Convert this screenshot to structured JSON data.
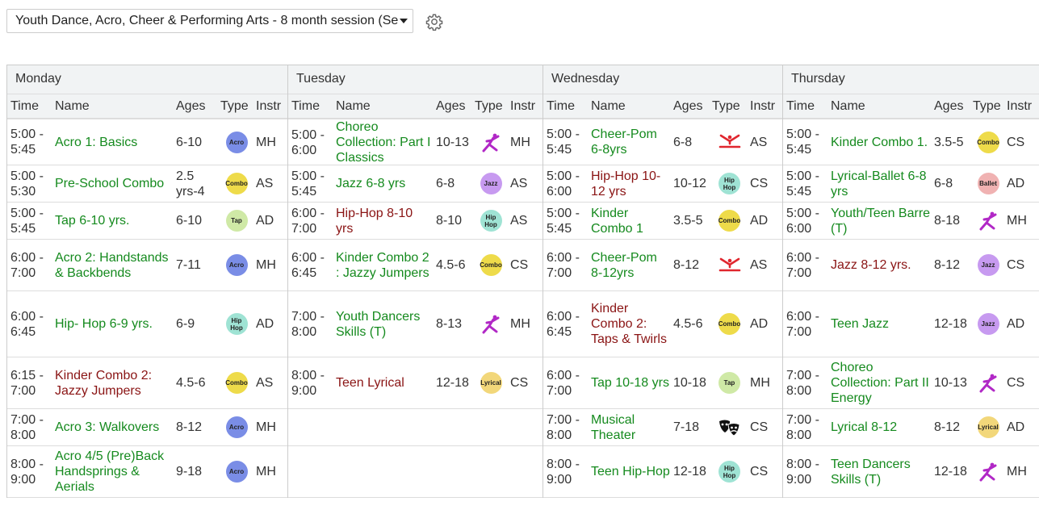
{
  "session": {
    "selected": "Youth Dance, Acro, Cheer & Performing Arts - 8 month session (Se"
  },
  "columns": {
    "time": "Time",
    "name": "Name",
    "ages": "Ages",
    "type": "Type",
    "instr": "Instr"
  },
  "type_badges": {
    "acro": {
      "label": "Acro",
      "color": "#7a8de6"
    },
    "combo": {
      "label": "Combo",
      "color": "#eedb4a"
    },
    "tap": {
      "label": "Tap",
      "color": "#cfe9a6"
    },
    "hiphop": {
      "label": "Hip Hop",
      "color": "#9fe3d4"
    },
    "jazz": {
      "label": "Jazz",
      "color": "#c79af0"
    },
    "ballet": {
      "label": "Ballet",
      "color": "#f0b2b2"
    },
    "lyrical": {
      "label": "Lyrical",
      "color": "#f2d77a"
    }
  },
  "days": [
    {
      "name": "Monday",
      "rows": [
        {
          "time": "5:00 - 5:45",
          "name": "Acro 1: Basics",
          "ages": "6-10",
          "type": "acro",
          "instr": "MH",
          "red": false
        },
        {
          "time": "5:00 - 5:30",
          "name": "Pre-School Combo",
          "ages": "2.5 yrs-4",
          "type": "combo",
          "instr": "AS",
          "red": false
        },
        {
          "time": "5:00 - 5:45",
          "name": "Tap 6-10 yrs.",
          "ages": "6-10",
          "type": "tap",
          "instr": "AD",
          "red": false
        },
        {
          "time": "6:00 - 7:00",
          "name": "Acro 2: Handstands & Backbends",
          "ages": "7-11",
          "type": "acro",
          "instr": "MH",
          "red": false
        },
        {
          "time": "6:00 - 6:45",
          "name": "Hip- Hop 6-9 yrs.",
          "ages": "6-9",
          "type": "hiphop",
          "instr": "AD",
          "red": false
        },
        {
          "time": "6:15 - 7:00",
          "name": "Kinder Combo 2: Jazzy Jumpers",
          "ages": "4.5-6",
          "type": "combo",
          "instr": "AS",
          "red": true
        },
        {
          "time": "7:00 - 8:00",
          "name": "Acro 3: Walkovers",
          "ages": "8-12",
          "type": "acro",
          "instr": "MH",
          "red": false
        },
        {
          "time": "8:00 - 9:00",
          "name": "Acro 4/5 (Pre)Back Handsprings & Aerials",
          "ages": "9-18",
          "type": "acro",
          "instr": "MH",
          "red": false
        }
      ]
    },
    {
      "name": "Tuesday",
      "rows": [
        {
          "time": "5:00 - 6:00",
          "name": "Choreo Collection: Part I Classics",
          "ages": "10-13",
          "type": "dancer",
          "instr": "MH",
          "red": false
        },
        {
          "time": "5:00 - 5:45",
          "name": "Jazz 6-8 yrs",
          "ages": "6-8",
          "type": "jazz",
          "instr": "AS",
          "red": false
        },
        {
          "time": "6:00 - 7:00",
          "name": "Hip-Hop 8-10 yrs",
          "ages": "8-10",
          "type": "hiphop",
          "instr": "AS",
          "red": true
        },
        {
          "time": "6:00 - 6:45",
          "name": "Kinder Combo 2 : Jazzy Jumpers",
          "ages": "4.5-6",
          "type": "combo",
          "instr": "CS",
          "red": false
        },
        {
          "time": "7:00 - 8:00",
          "name": "Youth Dancers Skills (T)",
          "ages": "8-13",
          "type": "dancer",
          "instr": "MH",
          "red": false
        },
        {
          "time": "8:00 - 9:00",
          "name": "Teen Lyrical",
          "ages": "12-18",
          "type": "lyrical",
          "instr": "CS",
          "red": true
        },
        {
          "time": "",
          "name": "",
          "ages": "",
          "type": "",
          "instr": "",
          "red": false
        },
        {
          "time": "",
          "name": "",
          "ages": "",
          "type": "",
          "instr": "",
          "red": false
        }
      ]
    },
    {
      "name": "Wednesday",
      "rows": [
        {
          "time": "5:00 - 5:45",
          "name": "Cheer-Pom 6-8yrs",
          "ages": "6-8",
          "type": "cheer",
          "instr": "AS",
          "red": false
        },
        {
          "time": "5:00 - 6:00",
          "name": "Hip-Hop 10-12 yrs",
          "ages": "10-12",
          "type": "hiphop",
          "instr": "CS",
          "red": true
        },
        {
          "time": "5:00 - 5:45",
          "name": "Kinder Combo 1",
          "ages": "3.5-5",
          "type": "combo",
          "instr": "AD",
          "red": false
        },
        {
          "time": "6:00 - 7:00",
          "name": "Cheer-Pom 8-12yrs",
          "ages": "8-12",
          "type": "cheer",
          "instr": "AS",
          "red": false
        },
        {
          "time": "6:00 - 6:45",
          "name": "Kinder Combo 2: Taps & Twirls",
          "ages": "4.5-6",
          "type": "combo",
          "instr": "AD",
          "red": true
        },
        {
          "time": "6:00 - 7:00",
          "name": "Tap 10-18 yrs",
          "ages": "10-18",
          "type": "tap",
          "instr": "MH",
          "red": false
        },
        {
          "time": "7:00 - 8:00",
          "name": "Musical Theater",
          "ages": "7-18",
          "type": "theater",
          "instr": "CS",
          "red": false
        },
        {
          "time": "8:00 - 9:00",
          "name": "Teen Hip-Hop",
          "ages": "12-18",
          "type": "hiphop",
          "instr": "CS",
          "red": false
        }
      ]
    },
    {
      "name": "Thursday",
      "rows": [
        {
          "time": "5:00 - 5:45",
          "name": "Kinder Combo 1.",
          "ages": "3.5-5",
          "type": "combo",
          "instr": "CS",
          "red": false
        },
        {
          "time": "5:00 - 5:45",
          "name": "Lyrical-Ballet 6-8 yrs",
          "ages": "6-8",
          "type": "ballet",
          "instr": "AD",
          "red": false
        },
        {
          "time": "5:00 - 6:00",
          "name": "Youth/Teen Barre (T)",
          "ages": "8-18",
          "type": "dancer",
          "instr": "MH",
          "red": false
        },
        {
          "time": "6:00 - 7:00",
          "name": "Jazz 8-12 yrs.",
          "ages": "8-12",
          "type": "jazz",
          "instr": "CS",
          "red": true
        },
        {
          "time": "6:00 - 7:00",
          "name": "Teen Jazz",
          "ages": "12-18",
          "type": "jazz",
          "instr": "AD",
          "red": false
        },
        {
          "time": "7:00 - 8:00",
          "name": "Choreo Collection: Part II Energy",
          "ages": "10-13",
          "type": "dancer",
          "instr": "CS",
          "red": false
        },
        {
          "time": "7:00 - 8:00",
          "name": "Lyrical 8-12",
          "ages": "8-12",
          "type": "lyrical",
          "instr": "AD",
          "red": false
        },
        {
          "time": "8:00 - 9:00",
          "name": "Teen Dancers Skills (T)",
          "ages": "12-18",
          "type": "dancer",
          "instr": "MH",
          "red": false
        }
      ]
    }
  ]
}
